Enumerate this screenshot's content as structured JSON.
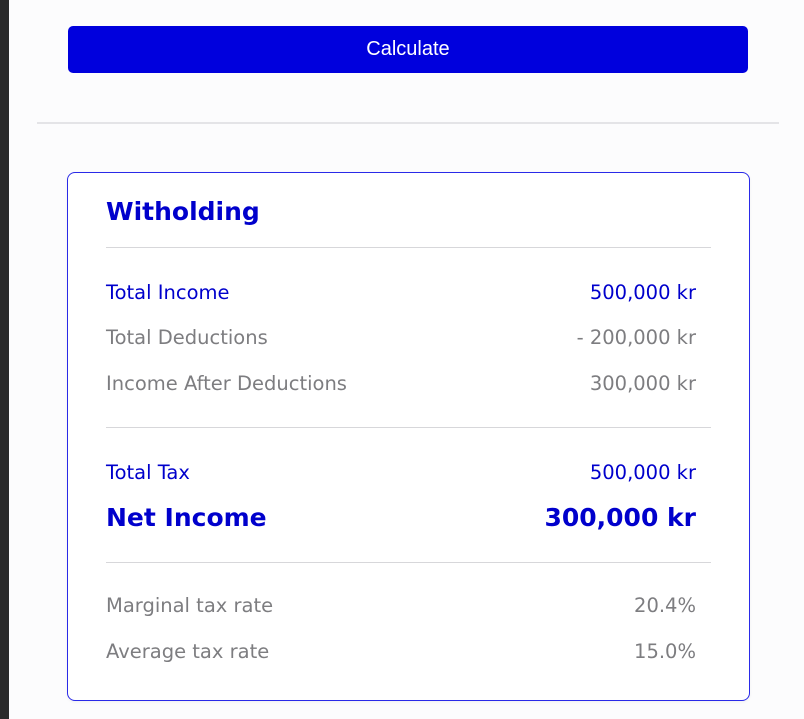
{
  "actions": {
    "calculate_label": "Calculate"
  },
  "withholding": {
    "title": "Witholding",
    "income": {
      "total_income_label": "Total Income",
      "total_income_value": "500,000 kr",
      "total_deductions_label": "Total Deductions",
      "total_deductions_value": "- 200,000 kr",
      "income_after_deductions_label": "Income After Deductions",
      "income_after_deductions_value": "300,000 kr"
    },
    "tax": {
      "total_tax_label": "Total Tax",
      "total_tax_value": "500,000 kr",
      "net_income_label": "Net Income",
      "net_income_value": "300,000 kr"
    },
    "rates": {
      "marginal_label": "Marginal tax rate",
      "marginal_value": "20.4%",
      "average_label": "Average tax rate",
      "average_value": "15.0%"
    }
  },
  "colors": {
    "accent": "#0000dd",
    "text_primary": "#0000cc",
    "text_secondary": "#7d7d80",
    "card_border": "#2a2ae8"
  }
}
